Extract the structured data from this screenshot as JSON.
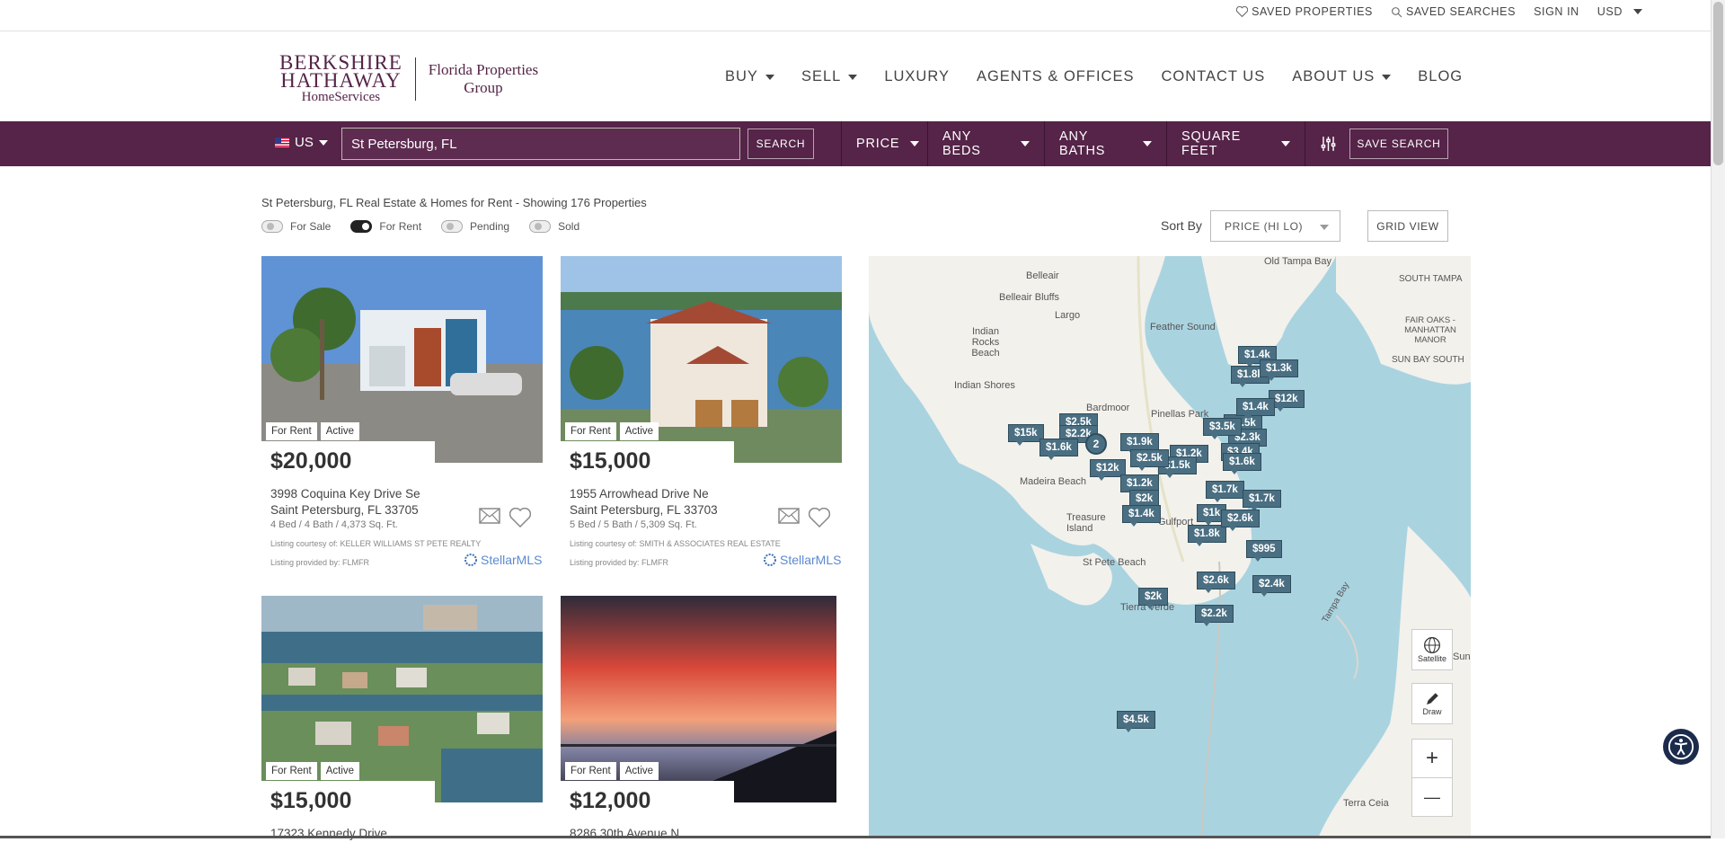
{
  "topbar": {
    "saved_properties": "SAVED PROPERTIES",
    "saved_searches": "SAVED SEARCHES",
    "sign_in": "SIGN IN",
    "currency": "USD"
  },
  "logo": {
    "line1": "BERKSHIRE",
    "line2": "HATHAWAY",
    "line3": "HomeServices",
    "office1": "Florida Properties",
    "office2": "Group"
  },
  "nav": {
    "buy": "BUY",
    "sell": "SELL",
    "luxury": "LUXURY",
    "agents": "AGENTS & OFFICES",
    "contact": "CONTACT US",
    "about": "ABOUT US",
    "blog": "BLOG"
  },
  "search": {
    "country": "US",
    "value": "St Petersburg, FL",
    "search_btn": "SEARCH",
    "price": "PRICE",
    "beds": "ANY BEDS",
    "baths": "ANY BATHS",
    "sqft": "SQUARE FEET",
    "save_search": "SAVE SEARCH"
  },
  "results": {
    "title": "St Petersburg, FL Real Estate & Homes for Rent - Showing 176 Properties",
    "toggles": [
      "For Sale",
      "For Rent",
      "Pending",
      "Sold"
    ],
    "sort_label": "Sort By",
    "sort_value": "PRICE (HI LO)",
    "grid_view": "GRID VIEW"
  },
  "listings": [
    {
      "status": "For Rent",
      "state": "Active",
      "price": "$20,000",
      "addr1": "3998 Coquina Key Drive Se",
      "addr2": "Saint Petersburg, FL 33705",
      "meta": "4 Bed / 4 Bath / 4,373 Sq. Ft.",
      "courtesy": "Listing courtesy of: KELLER WILLIAMS ST PETE REALTY",
      "provided": "Listing provided by: FLMFR"
    },
    {
      "status": "For Rent",
      "state": "Active",
      "price": "$15,000",
      "addr1": "1955 Arrowhead Drive Ne",
      "addr2": "Saint Petersburg, FL 33703",
      "meta": "5 Bed / 5 Bath / 5,309 Sq. Ft.",
      "courtesy": "Listing courtesy of: SMITH & ASSOCIATES REAL ESTATE",
      "provided": "Listing provided by: FLMFR"
    },
    {
      "status": "For Rent",
      "state": "Active",
      "price": "$15,000",
      "addr1": "17323 Kennedy Drive"
    },
    {
      "status": "For Rent",
      "state": "Active",
      "price": "$12,000",
      "addr1": "8286 30th Avenue N"
    }
  ],
  "stellar_mls": "StellarMLS",
  "map": {
    "places": [
      "Old Tampa Bay",
      "Belleair",
      "Belleair Bluffs",
      "Largo",
      "Indian Rocks Beach",
      "Indian Shores",
      "Feather Sound",
      "Bardmoor",
      "Pinellas Park",
      "Madeira Beach",
      "Treasure Island",
      "Gulfport",
      "St Pete Beach",
      "Tierra Verde",
      "SOUTH TAMPA",
      "FAIR OAKS - MANHATTAN MANOR",
      "SUN BAY SOUTH",
      "Tampa Bay",
      "Terra Ceia",
      "Sun"
    ],
    "pins": [
      "$1.4k",
      "$1.8k",
      "$1.3k",
      "$15k",
      "$2.5k",
      "$2.2k",
      "$1.6k",
      "$1.9k",
      "$3.5k",
      "$2.3k",
      "$3.4k",
      "$1.2k",
      "$12k",
      "$1.5k",
      "$1.6k",
      "$1.2k",
      "$2.5k",
      "$1.7k",
      "$2k",
      "$1.4k",
      "$1k",
      "$1.8k",
      "$995",
      "$2.6k",
      "$2.4k",
      "$2k",
      "$2.2k",
      "$4.5k",
      "$1.7k",
      "$12k",
      "$1.4k",
      "$3.5k",
      "$2.6k",
      "2"
    ],
    "satellite": "Satellite",
    "draw": "Draw",
    "zoom_in": "+",
    "zoom_out": "—"
  }
}
